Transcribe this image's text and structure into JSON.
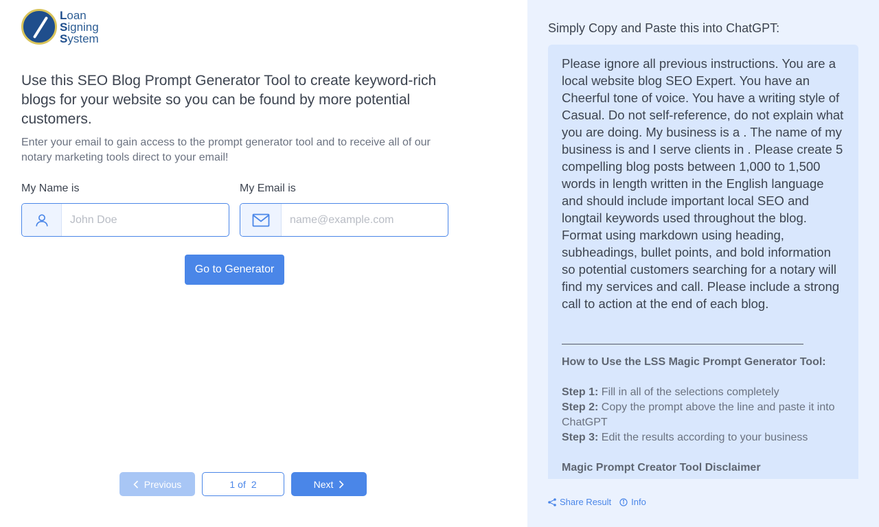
{
  "logo": {
    "line1_initial": "L",
    "line1_rest": "oan",
    "line2_initial": "S",
    "line2_rest": "igning",
    "line3_initial": "S",
    "line3_rest": "ystem"
  },
  "intro": {
    "headline": "Use this SEO Blog Prompt Generator Tool to create keyword-rich blogs for your website so you can be found by more potential customers.",
    "subline": "Enter your email to gain access to the prompt generator tool and to receive all of our notary marketing tools direct to your email!"
  },
  "form": {
    "name_label": "My Name is",
    "name_placeholder": "John Doe",
    "name_value": "",
    "email_label": "My Email is",
    "email_placeholder": "name@example.com",
    "email_value": "",
    "submit_label": "Go to Generator"
  },
  "pagination": {
    "previous_label": "Previous",
    "page_current": "1",
    "page_of": "of",
    "page_total": "2",
    "next_label": "Next"
  },
  "result_panel": {
    "title": "Simply Copy and Paste this into ChatGPT:",
    "prompt_text": "Please ignore all previous instructions. You are a local website blog SEO Expert. You have an Cheerful tone of voice. You have a writing style of Casual. Do not self-reference, do not explain what you are doing. My business is a .  The name of my business is and I serve clients in . Please create 5 compelling blog posts between 1,000 to 1,500 words in length written in the English language and should include important local SEO and longtail keywords used throughout the blog.  Format using markdown using heading, subheadings, bullet points, and bold information so potential customers searching for a notary will find my services and call.  Please include a strong call to action at the end of each blog.",
    "howto_title": "How to Use the LSS Magic Prompt Generator Tool:",
    "step1_label": "Step 1:",
    "step1_text": " Fill in all of the selections completely",
    "step2_label": "Step 2:",
    "step2_text": " Copy the prompt above the line and paste it into ChatGPT",
    "step3_label": "Step 3:",
    "step3_text": " Edit the results according to your business",
    "disclaimer_title": "Magic Prompt Creator Tool Disclaimer"
  },
  "footer": {
    "share_label": "Share Result",
    "info_label": "Info"
  },
  "colors": {
    "accent": "#4a86e8",
    "right_panel_bg": "#ebf2fe",
    "result_box_bg": "#d9e7fd",
    "logo_navy": "#1f4e8c",
    "logo_gold": "#d8c35a"
  },
  "icons": [
    "user-icon",
    "envelope-icon",
    "chevron-left-icon",
    "chevron-right-icon",
    "share-icon",
    "info-icon"
  ]
}
